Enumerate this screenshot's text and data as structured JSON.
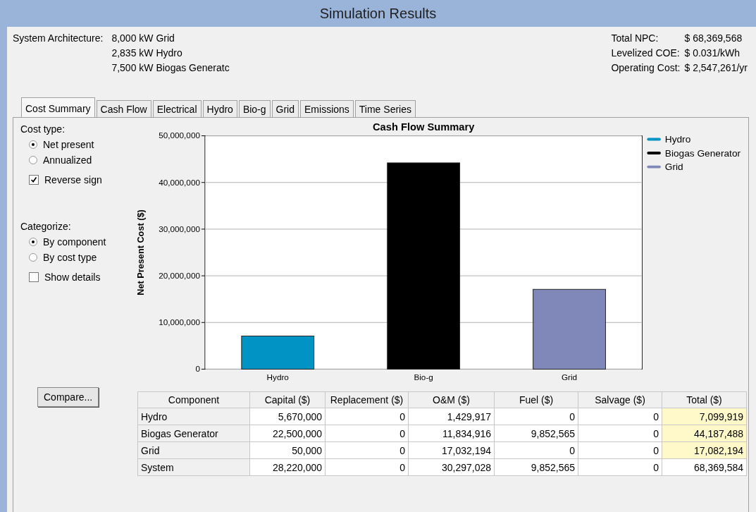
{
  "window": {
    "title": "Simulation Results"
  },
  "architecture": {
    "label": "System Architecture:",
    "items": [
      "8,000 kW Grid",
      "2,835 kW Hydro",
      "7,500 kW Biogas Generatc"
    ]
  },
  "summary": [
    {
      "label": "Total NPC:",
      "value": "$ 68,369,568"
    },
    {
      "label": "Levelized COE:",
      "value": "$ 0.031/kWh"
    },
    {
      "label": "Operating Cost:",
      "value": "$ 2,547,261/yr"
    }
  ],
  "tabs": [
    {
      "label": "Cost Summary",
      "selected": true
    },
    {
      "label": "Cash Flow",
      "selected": false
    },
    {
      "label": "Electrical",
      "selected": false
    },
    {
      "label": "Hydro",
      "selected": false
    },
    {
      "label": "Bio-g",
      "selected": false
    },
    {
      "label": "Grid",
      "selected": false
    },
    {
      "label": "Emissions",
      "selected": false
    },
    {
      "label": "Time Series",
      "selected": false
    }
  ],
  "options": [
    {
      "title": "Cost type:",
      "controls": [
        {
          "kind": "radio",
          "label": "Net present",
          "checked": true
        },
        {
          "kind": "radio",
          "label": "Annualized",
          "checked": false
        },
        {
          "kind": "checkbox",
          "label": "Reverse sign",
          "checked": true
        }
      ]
    },
    {
      "title": "Categorize:",
      "controls": [
        {
          "kind": "radio",
          "label": "By component",
          "checked": true
        },
        {
          "kind": "radio",
          "label": "By cost type",
          "checked": false
        },
        {
          "kind": "checkbox",
          "label": "Show details",
          "checked": false
        }
      ]
    }
  ],
  "chart": {
    "chart_data": {
      "type": "bar",
      "title": "Cash Flow Summary",
      "ylabel": "Net Present Cost ($)",
      "categories": [
        "Hydro",
        "Bio-g",
        "Grid"
      ],
      "series": [
        {
          "name": "Hydro",
          "color": "#0093c4",
          "values": [
            7100000,
            null,
            null
          ]
        },
        {
          "name": "Biogas Generator",
          "color": "#000000",
          "values": [
            null,
            44200000,
            null
          ]
        },
        {
          "name": "Grid",
          "color": "#7f88b8",
          "values": [
            null,
            null,
            17100000
          ]
        }
      ],
      "grid": true,
      "legend": true,
      "ylim": [
        0,
        50000000
      ],
      "yticks": [
        {
          "value": 0,
          "label": "0"
        },
        {
          "value": 10000000,
          "label": "10,000,000"
        },
        {
          "value": 20000000,
          "label": "20,000,000"
        },
        {
          "value": 30000000,
          "label": "30,000,000"
        },
        {
          "value": 40000000,
          "label": "40,000,000"
        },
        {
          "value": 50000000,
          "label": "50,000,000"
        }
      ]
    }
  },
  "compare_button": "Compare...",
  "table": {
    "columns": [
      "Component",
      "Capital ($)",
      "Replacement ($)",
      "O&M ($)",
      "Fuel ($)",
      "Salvage ($)",
      "Total ($)"
    ],
    "rows": [
      {
        "cells": [
          "Hydro",
          "5,670,000",
          "0",
          "1,429,917",
          "0",
          "0",
          "7,099,919"
        ],
        "total_highlighted": true
      },
      {
        "cells": [
          "Biogas Generator",
          "22,500,000",
          "0",
          "11,834,916",
          "9,852,565",
          "0",
          "44,187,488"
        ],
        "total_highlighted": true
      },
      {
        "cells": [
          "Grid",
          "50,000",
          "0",
          "17,032,194",
          "0",
          "0",
          "17,082,194"
        ],
        "total_highlighted": true
      },
      {
        "cells": [
          "System",
          "28,220,000",
          "0",
          "30,297,028",
          "9,852,565",
          "0",
          "68,369,584"
        ],
        "total_highlighted": false
      }
    ]
  }
}
